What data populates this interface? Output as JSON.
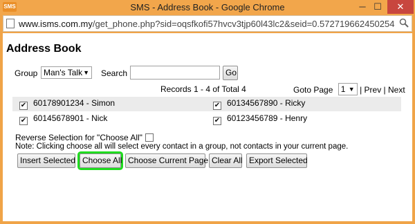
{
  "window": {
    "app_icon_text": "SMS",
    "title": "SMS - Address Book - Google Chrome",
    "minimize": "─",
    "maximize": "☐",
    "close": "✕"
  },
  "address_bar": {
    "host": "www.isms.com.my",
    "path": "/get_phone.php?sid=oqsfkofi57hvcv3tjp60l43lc2&seid=0.572719662450254",
    "zoom_icon": "magnifier-icon"
  },
  "page": {
    "title": "Address Book",
    "group_label": "Group",
    "group_selected": "Man's Talk",
    "search_label": "Search",
    "search_value": "",
    "go_button": "Go",
    "records_text": "Records 1 - 4 of Total 4",
    "goto_label": "Goto Page",
    "goto_selected": "1",
    "prev_text": "| Prev |",
    "next_text": "Next",
    "contacts": [
      {
        "label": "60178901234 - Simon",
        "checked": true
      },
      {
        "label": "60134567890 - Ricky",
        "checked": true
      },
      {
        "label": "60145678901 - Nick",
        "checked": true
      },
      {
        "label": "60123456789 - Henry",
        "checked": true
      }
    ],
    "reverse_label": "Reverse Selection for \"Choose All\"",
    "reverse_checked": false,
    "note": "Note: Clicking choose all will select every contact in a group, not contacts in your current page.",
    "buttons": {
      "insert_selected": "Insert Selected",
      "choose_all": "Choose All",
      "choose_current_page": "Choose Current Page",
      "clear_all": "Clear All",
      "export_selected": "Export Selected"
    },
    "highlight_color": "#1fdc1f"
  }
}
